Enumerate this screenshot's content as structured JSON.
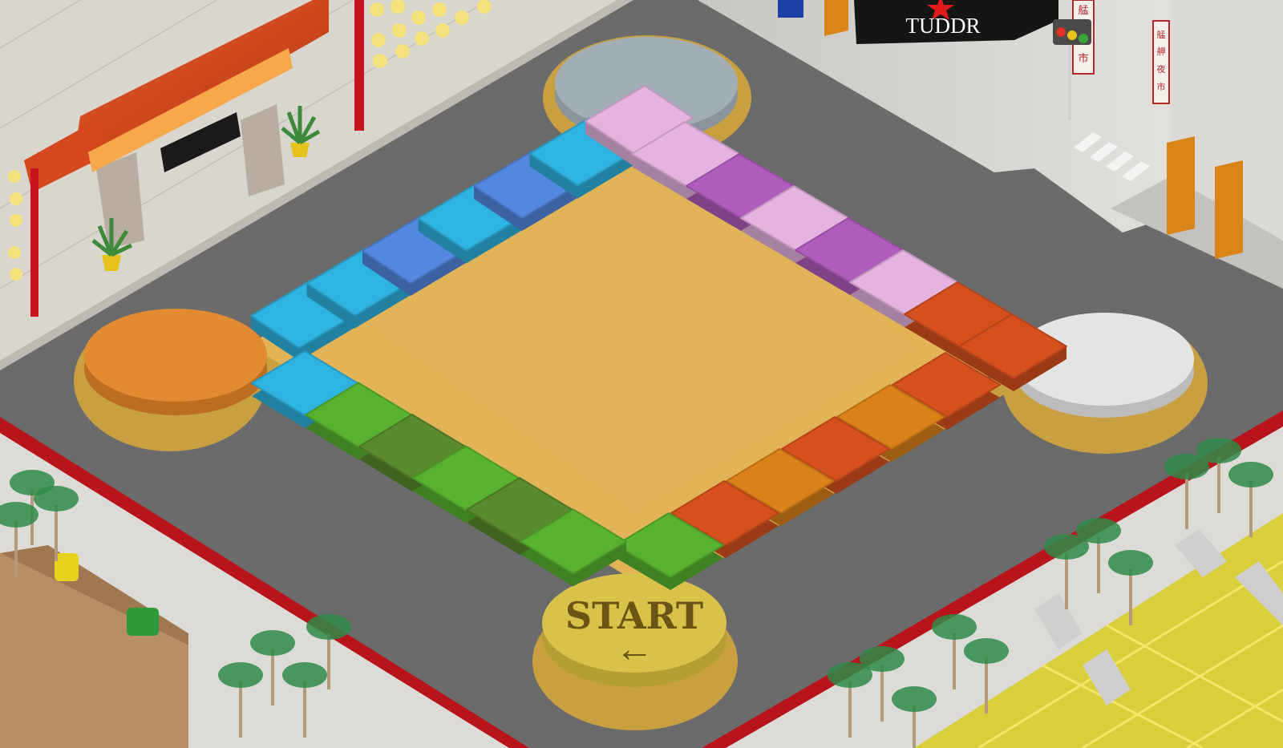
{
  "start_space": {
    "label": "START",
    "arrow": "←"
  },
  "store_sign": {
    "label": "TUDDR"
  },
  "vertical_signs": {
    "left": [
      "艋",
      "舺",
      "市"
    ],
    "right": [
      "艋",
      "舺",
      "夜",
      "市"
    ]
  },
  "corner_spaces": {
    "top": "#a3adb4",
    "left": "#e38b32",
    "right": "#e4e4e4",
    "bottom": "#d8c24a"
  },
  "board_colors": {
    "board": "#e2b457",
    "center": "#e0b359",
    "cyan": "#2fb3e0",
    "blue": "#5488e0",
    "pink": "#e4b3e0",
    "purple": "#b05cbc",
    "red_orange": "#d6501e",
    "orange": "#da8119",
    "green_light": "#58b22f",
    "green_dark": "#5a8a2d"
  },
  "path_tiles": {
    "top_left_side": [
      "cyan",
      "cyan",
      "blue",
      "cyan",
      "blue",
      "cyan",
      "pink"
    ],
    "top_right_side": [
      "pink",
      "purple",
      "pink",
      "purple",
      "pink",
      "red_orange",
      "red_orange"
    ],
    "bottom_right_side": [
      "red_orange",
      "orange",
      "red_orange",
      "orange",
      "red_orange",
      "green_light"
    ],
    "bottom_left_side": [
      "cyan",
      "green_light",
      "green_dark",
      "green_light",
      "green_dark",
      "green_light"
    ]
  },
  "traffic_light_icon": "traffic-light-icon",
  "gate_icon": "temple-gate-icon",
  "tree_icon": "tree-icon",
  "plant_icon": "potted-plant-icon"
}
